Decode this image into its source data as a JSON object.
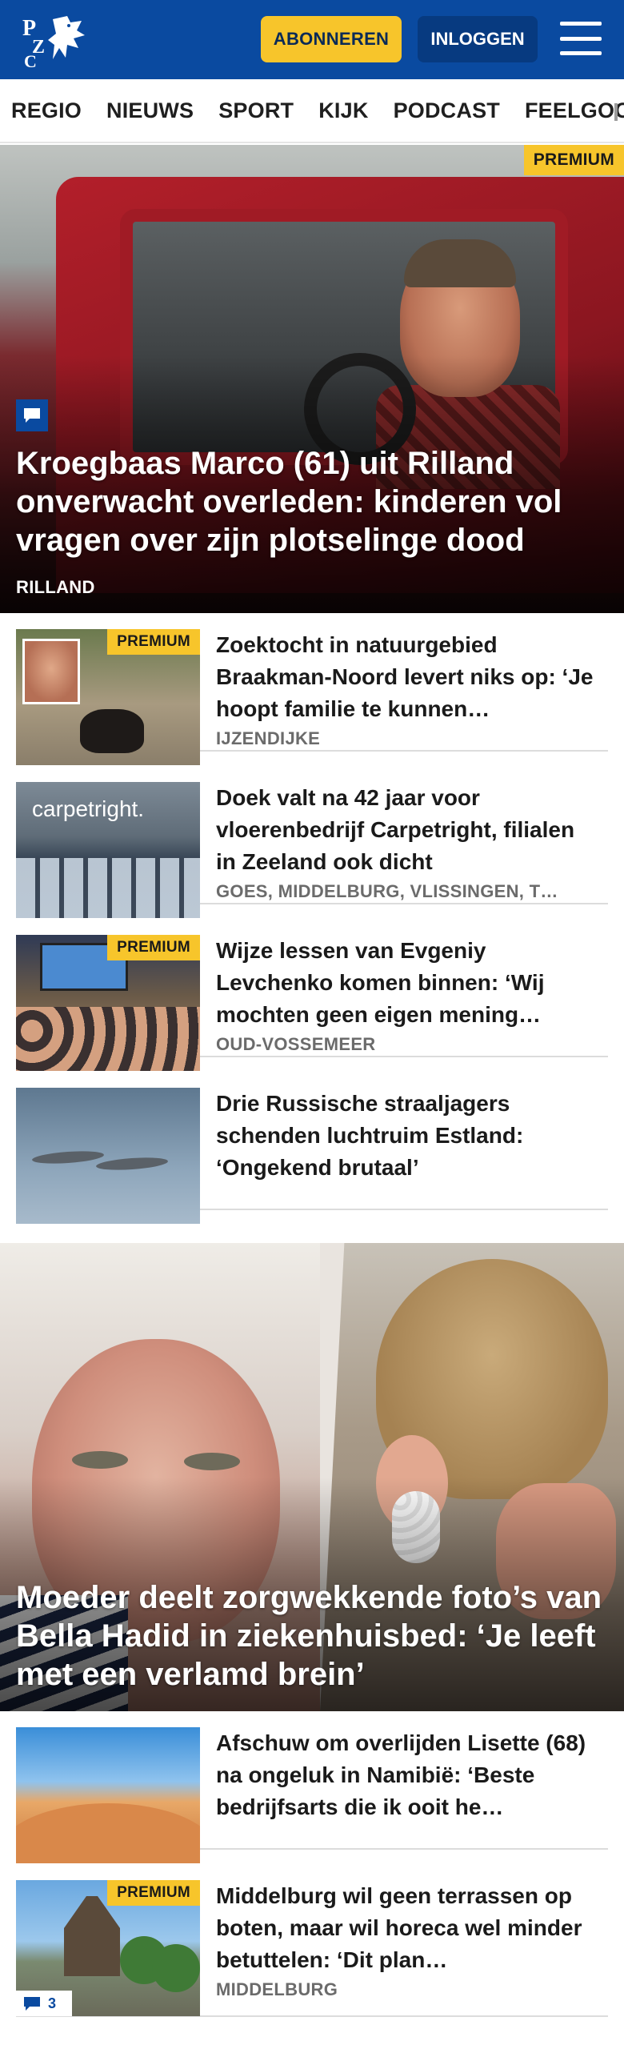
{
  "header": {
    "logo_text": "PZC",
    "subscribe_label": "ABONNEREN",
    "login_label": "INLOGGEN",
    "brand_color": "#0a4aa0",
    "accent_color": "#f7c52b"
  },
  "nav": {
    "items": [
      "REGIO",
      "NIEUWS",
      "SPORT",
      "KIJK",
      "PODCAST",
      "FEELGOOD"
    ]
  },
  "hero1": {
    "badge": "PREMIUM",
    "title": "Kroegbaas Marco (61) uit Rilland onverwacht overleden: kinderen vol vragen over zijn plotselinge dood",
    "location": "RILLAND",
    "icon": "comment-icon"
  },
  "articles": [
    {
      "badge": "PREMIUM",
      "title": "Zoektocht in natuurgebied Braakman-Noord levert niks op: ‘Je hoopt familie te kunnen…",
      "location": "IJZENDIJKE"
    },
    {
      "title": "Doek valt na 42 jaar voor vloerenbedrijf Carpetright, filialen in Zeeland ook dicht",
      "location": "GOES, MIDDELBURG, VLISSINGEN, T…",
      "thumb_sign": "carpetright."
    },
    {
      "badge": "PREMIUM",
      "title": "Wijze lessen van Evgeniy Levchenko komen binnen: ‘Wij mochten geen eigen mening…",
      "location": "OUD-VOSSEMEER"
    },
    {
      "title": "Drie Russische straaljagers schenden luchtruim Estland: ‘Ongekend brutaal’"
    }
  ],
  "hero2": {
    "title": "Moeder deelt zorgwekkende foto’s van Bella Hadid in ziekenhuisbed: ‘Je leeft met een verlamd brein’"
  },
  "articles2": [
    {
      "title": "Afschuw om overlijden Lisette (68) na ongeluk in Namibië: ‘Beste bedrijfsarts die ik ooit he…"
    },
    {
      "badge": "PREMIUM",
      "title": "Middelburg wil geen terrassen op boten, maar wil horeca wel minder betuttelen: ‘Dit plan…",
      "location": "MIDDELBURG",
      "comments": "3"
    }
  ]
}
